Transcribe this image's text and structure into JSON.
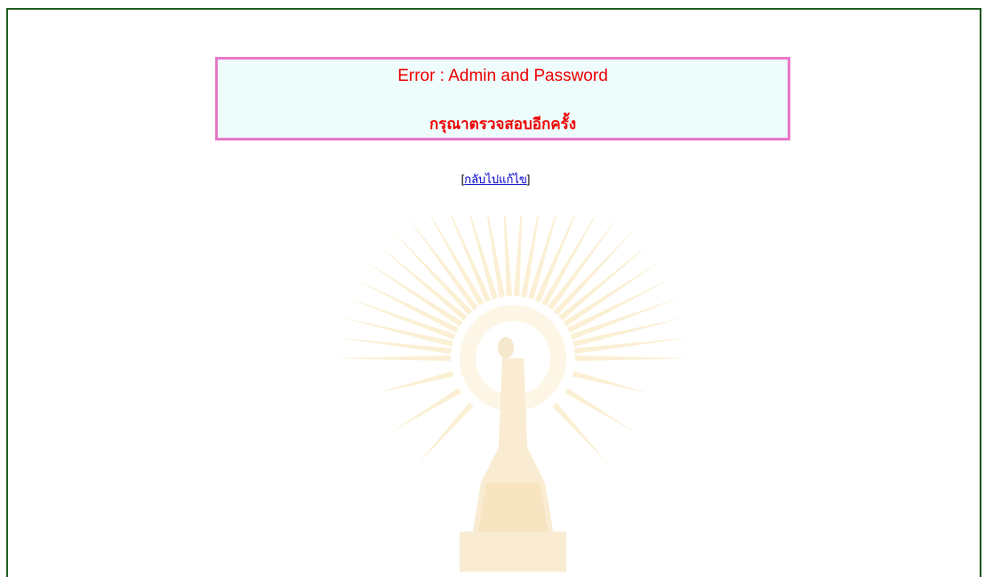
{
  "error": {
    "title": "Error : Admin and Password",
    "message": "กรุณาตรวจสอบอีกครั้ง"
  },
  "back": {
    "bracket_open": "[",
    "link_label": "กลับไปแก้ไข",
    "bracket_close": "]"
  },
  "colors": {
    "frame_border": "#1f5a1f",
    "box_border": "#e878c8",
    "box_background": "#eefdfc",
    "error_text": "#ee0000",
    "link": "#0000cc",
    "watermark": "#fbeed0"
  },
  "watermark": {
    "icon": "university-emblem-icon"
  }
}
